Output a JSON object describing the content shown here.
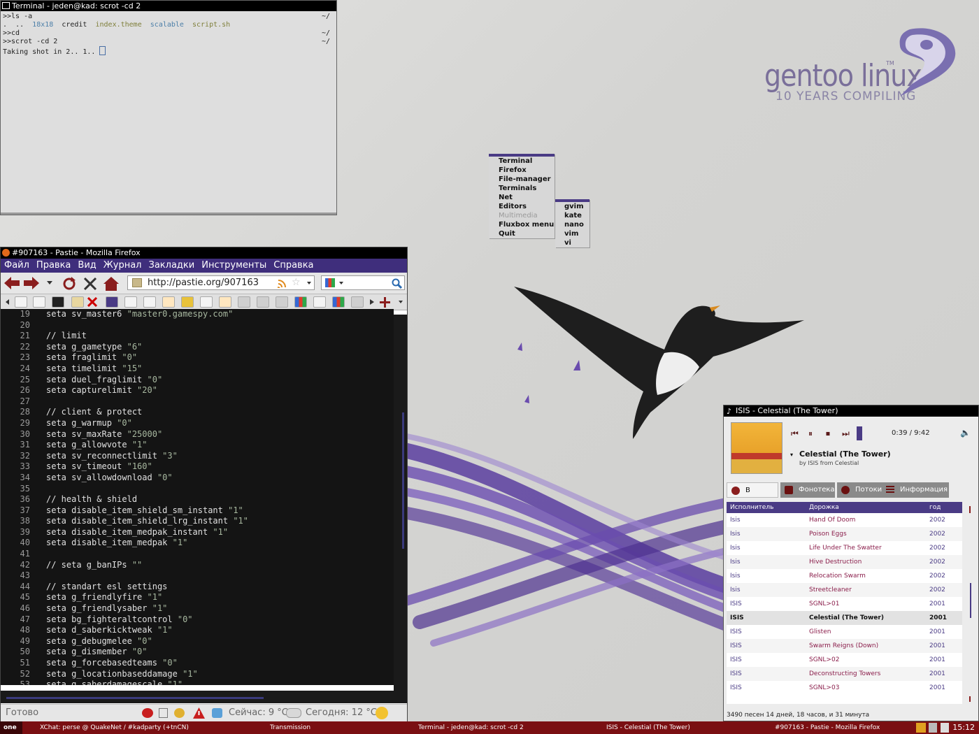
{
  "terminal": {
    "title": "Terminal - jeden@kad: scrot -cd 2",
    "prompt1": ">>ls -a",
    "ls": [
      ".",
      "..",
      "18x18",
      "credit",
      "index.theme",
      "scalable",
      "script.sh"
    ],
    "prompt2": ">>cd",
    "prompt3": ">>scrot -cd 2",
    "output": "Taking shot in 2.. 1..",
    "tilde": "~/"
  },
  "menu": {
    "items": [
      "Terminal",
      "Firefox",
      "File-manager",
      "Terminals",
      "Net",
      "Editors",
      "Multimedia",
      "Fluxbox menu",
      "Quit"
    ],
    "submenu": [
      "gvim",
      "kate",
      "nano",
      "vim",
      "vi"
    ]
  },
  "logo": {
    "name": "gentoo linux",
    "tm": "TM",
    "tagline": "10 YEARS COMPILING"
  },
  "firefox": {
    "title": "#907163 - Pastie - Mozilla Firefox",
    "menus": [
      "Файл",
      "Правка",
      "Вид",
      "Журнал",
      "Закладки",
      "Инструменты",
      "Справка"
    ],
    "url": "http://pastie.org/907163",
    "lines": [
      {
        "n": "19",
        "code": "seta sv_master6 ",
        "str": "\"master0.gamespy.com\""
      },
      {
        "n": "20",
        "code": "",
        "str": ""
      },
      {
        "n": "21",
        "code": "// limit",
        "str": ""
      },
      {
        "n": "22",
        "code": "seta g_gametype ",
        "str": "\"6\""
      },
      {
        "n": "23",
        "code": "seta fraglimit ",
        "str": "\"0\""
      },
      {
        "n": "24",
        "code": "seta timelimit ",
        "str": "\"15\""
      },
      {
        "n": "25",
        "code": "seta duel_fraglimit ",
        "str": "\"0\""
      },
      {
        "n": "26",
        "code": "seta capturelimit ",
        "str": "\"20\""
      },
      {
        "n": "27",
        "code": "",
        "str": ""
      },
      {
        "n": "28",
        "code": "// client & protect",
        "str": ""
      },
      {
        "n": "29",
        "code": "seta g_warmup ",
        "str": "\"0\""
      },
      {
        "n": "30",
        "code": "seta sv_maxRate ",
        "str": "\"25000\""
      },
      {
        "n": "31",
        "code": "seta g_allowvote ",
        "str": "\"1\""
      },
      {
        "n": "32",
        "code": "seta sv_reconnectlimit ",
        "str": "\"3\""
      },
      {
        "n": "33",
        "code": "seta sv_timeout ",
        "str": "\"160\""
      },
      {
        "n": "34",
        "code": "seta sv_allowdownload ",
        "str": "\"0\""
      },
      {
        "n": "35",
        "code": "",
        "str": ""
      },
      {
        "n": "36",
        "code": "// health & shield",
        "str": ""
      },
      {
        "n": "37",
        "code": "seta disable_item_shield_sm_instant ",
        "str": "\"1\""
      },
      {
        "n": "38",
        "code": "seta disable_item_shield_lrg_instant ",
        "str": "\"1\""
      },
      {
        "n": "39",
        "code": "seta disable_item_medpak_instant ",
        "str": "\"1\""
      },
      {
        "n": "40",
        "code": "seta disable_item_medpak ",
        "str": "\"1\""
      },
      {
        "n": "41",
        "code": "",
        "str": ""
      },
      {
        "n": "42",
        "code": "// seta g_banIPs ",
        "str": "\"\""
      },
      {
        "n": "43",
        "code": "",
        "str": ""
      },
      {
        "n": "44",
        "code": "// standart esl settings",
        "str": ""
      },
      {
        "n": "45",
        "code": "seta g_friendlyfire ",
        "str": "\"1\""
      },
      {
        "n": "46",
        "code": "seta g_friendlysaber ",
        "str": "\"1\""
      },
      {
        "n": "47",
        "code": "seta bg_fighteraltcontrol ",
        "str": "\"0\""
      },
      {
        "n": "48",
        "code": "seta d_saberkicktweak ",
        "str": "\"1\""
      },
      {
        "n": "49",
        "code": "seta g_debugmelee ",
        "str": "\"0\""
      },
      {
        "n": "50",
        "code": "seta g_dismember ",
        "str": "\"0\""
      },
      {
        "n": "51",
        "code": "seta g_forcebasedteams ",
        "str": "\"0\""
      },
      {
        "n": "52",
        "code": "seta g_locationbaseddamage ",
        "str": "\"1\""
      },
      {
        "n": "53",
        "code": "seta g_saberdamagescale ",
        "str": "\"1\""
      }
    ],
    "status": "Готово",
    "weather_now": "Сейчас: 9 °C",
    "weather_today": "Сегодня: 12 °C"
  },
  "player": {
    "title": "ISIS - Celestial (The Tower)",
    "time": "0:39 / 9:42",
    "track": "Celestial (The Tower)",
    "by": "by ISIS from Celestial",
    "tabs": [
      "В ротации",
      "Фонотека",
      "Потоки",
      "Информация"
    ],
    "headers": [
      "Исполнитель",
      "Дорожка",
      "год"
    ],
    "rows": [
      [
        "Isis",
        "Hand Of Doom",
        "2002"
      ],
      [
        "Isis",
        "Poison Eggs",
        "2002"
      ],
      [
        "Isis",
        "Life Under The Swatter",
        "2002"
      ],
      [
        "Isis",
        "Hive Destruction",
        "2002"
      ],
      [
        "Isis",
        "Relocation Swarm",
        "2002"
      ],
      [
        "Isis",
        "Streetcleaner",
        "2002"
      ],
      [
        "ISIS",
        "SGNL>01",
        "2001"
      ],
      [
        "ISIS",
        "Celestial (The Tower)",
        "2001"
      ],
      [
        "ISIS",
        "Glisten",
        "2001"
      ],
      [
        "ISIS",
        "Swarm Reigns (Down)",
        "2001"
      ],
      [
        "ISIS",
        "SGNL>02",
        "2001"
      ],
      [
        "ISIS",
        "Deconstructing Towers",
        "2001"
      ],
      [
        "ISIS",
        "SGNL>03",
        "2001"
      ]
    ],
    "footer": "3490 песен    14 дней, 18 часов, и 31 минута"
  },
  "taskbar": {
    "workspace": "one",
    "tasks": [
      "XChat: perse @ QuakeNet / #kadparty (+tnCN)",
      "Transmission",
      "Terminal - jeden@kad: scrot -cd 2",
      "ISIS - Celestial (The Tower)",
      "#907163 - Pastie - Mozilla Firefox"
    ],
    "clock": "15:12"
  }
}
